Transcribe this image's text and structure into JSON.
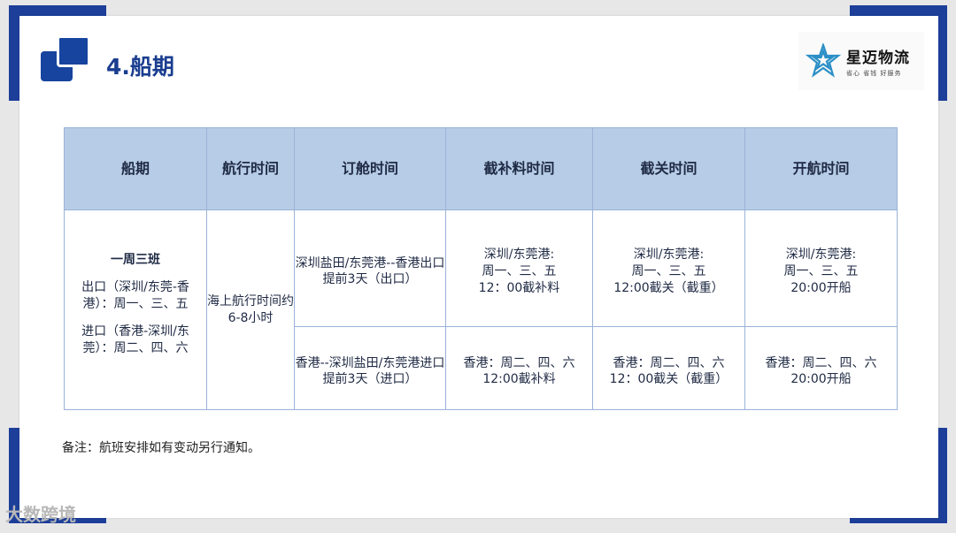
{
  "header": {
    "title": "4.船期"
  },
  "logo": {
    "name": "星迈物流",
    "slogan": "省心  省钱  好服务",
    "color": "#2b8fc6"
  },
  "table": {
    "headers": [
      "船期",
      "航行时间",
      "订舱时间",
      "截补料时间",
      "截关时间",
      "开航时间"
    ],
    "schedule": {
      "title": "一周三班",
      "export_line": "出口（深圳/东莞-香港）：周一、三、五",
      "import_line": "进口（香港-深圳/东莞）：周二、四、六"
    },
    "sailing_time": "海上航行时间约6-8小时",
    "rows": [
      {
        "booking": "深圳盐田/东莞港--香港出口提前3天（出口）",
        "cutoff_supplement": "深圳/东莞港:\n周一、三、五\n12：00截补料",
        "cutoff_customs": "深圳/东莞港:\n周一、三、五\n12:00截关（截重）",
        "departure": "深圳/东莞港:\n周一、三、五\n20:00开船"
      },
      {
        "booking": "香港--深圳盐田/东莞港进口提前3天（进口）",
        "cutoff_supplement": "香港：周二、四、六\n12:00截补料",
        "cutoff_customs": "香港：周二、四、六\n12：00截关（截重）",
        "departure": "香港：周二、四、六\n20:00开船"
      }
    ]
  },
  "note": "备注：航班安排如有变动另行通知。",
  "watermark": "大数跨境",
  "colors": {
    "brand_blue": "#1d3f99",
    "header_fill": "#b7cce6",
    "table_border": "#9ab3d8"
  }
}
